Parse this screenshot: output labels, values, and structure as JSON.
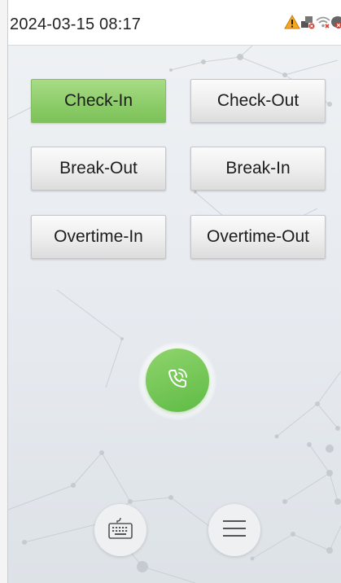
{
  "status_bar": {
    "datetime": "2024-03-15 08:17",
    "icons": [
      "warning-icon",
      "network-icon",
      "wifi-disconnected-icon",
      "cloud-disconnected-icon"
    ]
  },
  "punch_buttons": [
    {
      "label": "Check-In",
      "selected": true
    },
    {
      "label": "Check-Out",
      "selected": false
    },
    {
      "label": "Break-Out",
      "selected": false
    },
    {
      "label": "Break-In",
      "selected": false
    },
    {
      "label": "Overtime-In",
      "selected": false
    },
    {
      "label": "Overtime-Out",
      "selected": false
    }
  ],
  "actions": {
    "call_icon": "phone-call-icon",
    "keyboard_icon": "keyboard-icon",
    "menu_icon": "menu-icon"
  },
  "colors": {
    "selected_button": "#8ecd6a",
    "call_button": "#6cc24f",
    "warning": "#f5a623",
    "error": "#d93a2b"
  }
}
